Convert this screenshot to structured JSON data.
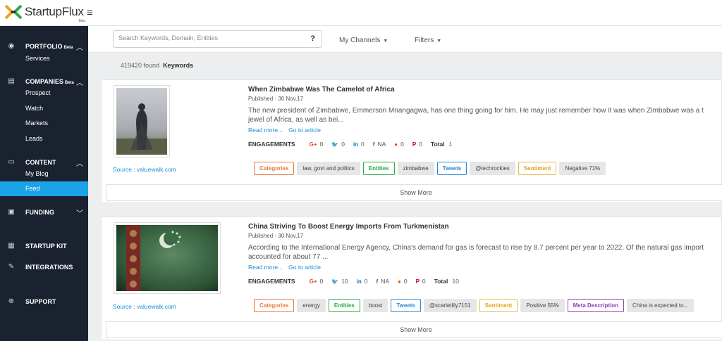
{
  "app": {
    "name": "StartupFlux",
    "beta": "Beta"
  },
  "search": {
    "placeholder": "Search Keywords, Domain, Entities",
    "help": "?"
  },
  "toolbar": {
    "channels": "My Channels",
    "filters": "Filters"
  },
  "results": {
    "count": "419420 found",
    "label": "Keywords"
  },
  "sidebar": {
    "portfolio": {
      "title": "PORTFOLIO",
      "beta": "Beta",
      "items": [
        "Services"
      ]
    },
    "companies": {
      "title": "COMPANIES",
      "beta": "Beta",
      "items": [
        "Prospect",
        "Watch",
        "Markets",
        "Leads"
      ]
    },
    "content": {
      "title": "CONTENT",
      "items": [
        "My Blog",
        "Feed"
      ]
    },
    "funding": {
      "title": "FUNDING"
    },
    "startup_kit": {
      "title": "STARTUP KIT"
    },
    "integrations": {
      "title": "INTEGRATIONS"
    },
    "support": {
      "title": "SUPPORT"
    }
  },
  "articles": [
    {
      "title": "When Zimbabwe Was The Camelot of Africa",
      "published": "Published - 30 Nov,17",
      "desc1": "The new president of Zimbabwe, Emmerson Mnangagwa, has one thing going for him. He may just remember how it was when Zimbabwe was a t",
      "desc2": "jewel of Africa, as well as bei...",
      "read_more": "Read more...",
      "go_to": "Go to article",
      "engagements": {
        "label": "ENGAGEMENTS",
        "gplus": "0",
        "twitter": "0",
        "linkedin": "0",
        "facebook": "NA",
        "reddit": "0",
        "pinterest": "0",
        "total_label": "Total",
        "total": "1"
      },
      "source": "Source : valuewalk.com",
      "tags": [
        {
          "key": "Categories",
          "color": "orange",
          "value": "law, govt and politics"
        },
        {
          "key": "Entities",
          "color": "green",
          "value": "zimbabwe"
        },
        {
          "key": "Tweets",
          "color": "blue",
          "value": "@techrockies"
        },
        {
          "key": "Sentiment",
          "color": "yellow",
          "value": "Negative 71%"
        }
      ],
      "show_more": "Show More"
    },
    {
      "title": "China Striving To Boost Energy Imports From Turkmenistan",
      "published": "Published - 30 Nov,17",
      "desc1": "According to the International Energy Agency, China's demand for gas is forecast to rise by 8.7 percent per year to 2022. Of the natural gas import",
      "desc2": "accounted for about 77 ...",
      "read_more": "Read more...",
      "go_to": "Go to article",
      "engagements": {
        "label": "ENGAGEMENTS",
        "gplus": "0",
        "twitter": "10",
        "linkedin": "0",
        "facebook": "NA",
        "reddit": "0",
        "pinterest": "0",
        "total_label": "Total",
        "total": "10"
      },
      "source": "Source : valuewalk.com",
      "tags": [
        {
          "key": "Categories",
          "color": "orange",
          "value": "energy"
        },
        {
          "key": "Entities",
          "color": "green",
          "value": "boost"
        },
        {
          "key": "Tweets",
          "color": "blue",
          "value": "@scarletlily7151"
        },
        {
          "key": "Sentiment",
          "color": "yellow",
          "value": "Positive 55%"
        },
        {
          "key": "Meta Description",
          "color": "purple",
          "value": "China is expected to..."
        }
      ],
      "show_more": "Show More"
    }
  ]
}
